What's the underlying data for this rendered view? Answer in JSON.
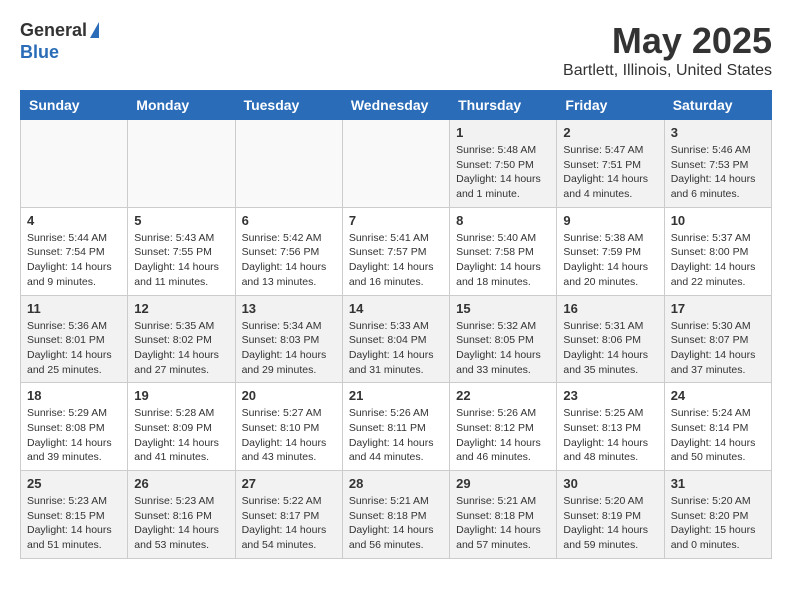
{
  "logo": {
    "general": "General",
    "blue": "Blue"
  },
  "title": "May 2025",
  "subtitle": "Bartlett, Illinois, United States",
  "weekdays": [
    "Sunday",
    "Monday",
    "Tuesday",
    "Wednesday",
    "Thursday",
    "Friday",
    "Saturday"
  ],
  "weeks": [
    [
      {
        "day": "",
        "content": ""
      },
      {
        "day": "",
        "content": ""
      },
      {
        "day": "",
        "content": ""
      },
      {
        "day": "",
        "content": ""
      },
      {
        "day": "1",
        "content": "Sunrise: 5:48 AM\nSunset: 7:50 PM\nDaylight: 14 hours and 1 minute."
      },
      {
        "day": "2",
        "content": "Sunrise: 5:47 AM\nSunset: 7:51 PM\nDaylight: 14 hours and 4 minutes."
      },
      {
        "day": "3",
        "content": "Sunrise: 5:46 AM\nSunset: 7:53 PM\nDaylight: 14 hours and 6 minutes."
      }
    ],
    [
      {
        "day": "4",
        "content": "Sunrise: 5:44 AM\nSunset: 7:54 PM\nDaylight: 14 hours and 9 minutes."
      },
      {
        "day": "5",
        "content": "Sunrise: 5:43 AM\nSunset: 7:55 PM\nDaylight: 14 hours and 11 minutes."
      },
      {
        "day": "6",
        "content": "Sunrise: 5:42 AM\nSunset: 7:56 PM\nDaylight: 14 hours and 13 minutes."
      },
      {
        "day": "7",
        "content": "Sunrise: 5:41 AM\nSunset: 7:57 PM\nDaylight: 14 hours and 16 minutes."
      },
      {
        "day": "8",
        "content": "Sunrise: 5:40 AM\nSunset: 7:58 PM\nDaylight: 14 hours and 18 minutes."
      },
      {
        "day": "9",
        "content": "Sunrise: 5:38 AM\nSunset: 7:59 PM\nDaylight: 14 hours and 20 minutes."
      },
      {
        "day": "10",
        "content": "Sunrise: 5:37 AM\nSunset: 8:00 PM\nDaylight: 14 hours and 22 minutes."
      }
    ],
    [
      {
        "day": "11",
        "content": "Sunrise: 5:36 AM\nSunset: 8:01 PM\nDaylight: 14 hours and 25 minutes."
      },
      {
        "day": "12",
        "content": "Sunrise: 5:35 AM\nSunset: 8:02 PM\nDaylight: 14 hours and 27 minutes."
      },
      {
        "day": "13",
        "content": "Sunrise: 5:34 AM\nSunset: 8:03 PM\nDaylight: 14 hours and 29 minutes."
      },
      {
        "day": "14",
        "content": "Sunrise: 5:33 AM\nSunset: 8:04 PM\nDaylight: 14 hours and 31 minutes."
      },
      {
        "day": "15",
        "content": "Sunrise: 5:32 AM\nSunset: 8:05 PM\nDaylight: 14 hours and 33 minutes."
      },
      {
        "day": "16",
        "content": "Sunrise: 5:31 AM\nSunset: 8:06 PM\nDaylight: 14 hours and 35 minutes."
      },
      {
        "day": "17",
        "content": "Sunrise: 5:30 AM\nSunset: 8:07 PM\nDaylight: 14 hours and 37 minutes."
      }
    ],
    [
      {
        "day": "18",
        "content": "Sunrise: 5:29 AM\nSunset: 8:08 PM\nDaylight: 14 hours and 39 minutes."
      },
      {
        "day": "19",
        "content": "Sunrise: 5:28 AM\nSunset: 8:09 PM\nDaylight: 14 hours and 41 minutes."
      },
      {
        "day": "20",
        "content": "Sunrise: 5:27 AM\nSunset: 8:10 PM\nDaylight: 14 hours and 43 minutes."
      },
      {
        "day": "21",
        "content": "Sunrise: 5:26 AM\nSunset: 8:11 PM\nDaylight: 14 hours and 44 minutes."
      },
      {
        "day": "22",
        "content": "Sunrise: 5:26 AM\nSunset: 8:12 PM\nDaylight: 14 hours and 46 minutes."
      },
      {
        "day": "23",
        "content": "Sunrise: 5:25 AM\nSunset: 8:13 PM\nDaylight: 14 hours and 48 minutes."
      },
      {
        "day": "24",
        "content": "Sunrise: 5:24 AM\nSunset: 8:14 PM\nDaylight: 14 hours and 50 minutes."
      }
    ],
    [
      {
        "day": "25",
        "content": "Sunrise: 5:23 AM\nSunset: 8:15 PM\nDaylight: 14 hours and 51 minutes."
      },
      {
        "day": "26",
        "content": "Sunrise: 5:23 AM\nSunset: 8:16 PM\nDaylight: 14 hours and 53 minutes."
      },
      {
        "day": "27",
        "content": "Sunrise: 5:22 AM\nSunset: 8:17 PM\nDaylight: 14 hours and 54 minutes."
      },
      {
        "day": "28",
        "content": "Sunrise: 5:21 AM\nSunset: 8:18 PM\nDaylight: 14 hours and 56 minutes."
      },
      {
        "day": "29",
        "content": "Sunrise: 5:21 AM\nSunset: 8:18 PM\nDaylight: 14 hours and 57 minutes."
      },
      {
        "day": "30",
        "content": "Sunrise: 5:20 AM\nSunset: 8:19 PM\nDaylight: 14 hours and 59 minutes."
      },
      {
        "day": "31",
        "content": "Sunrise: 5:20 AM\nSunset: 8:20 PM\nDaylight: 15 hours and 0 minutes."
      }
    ]
  ]
}
